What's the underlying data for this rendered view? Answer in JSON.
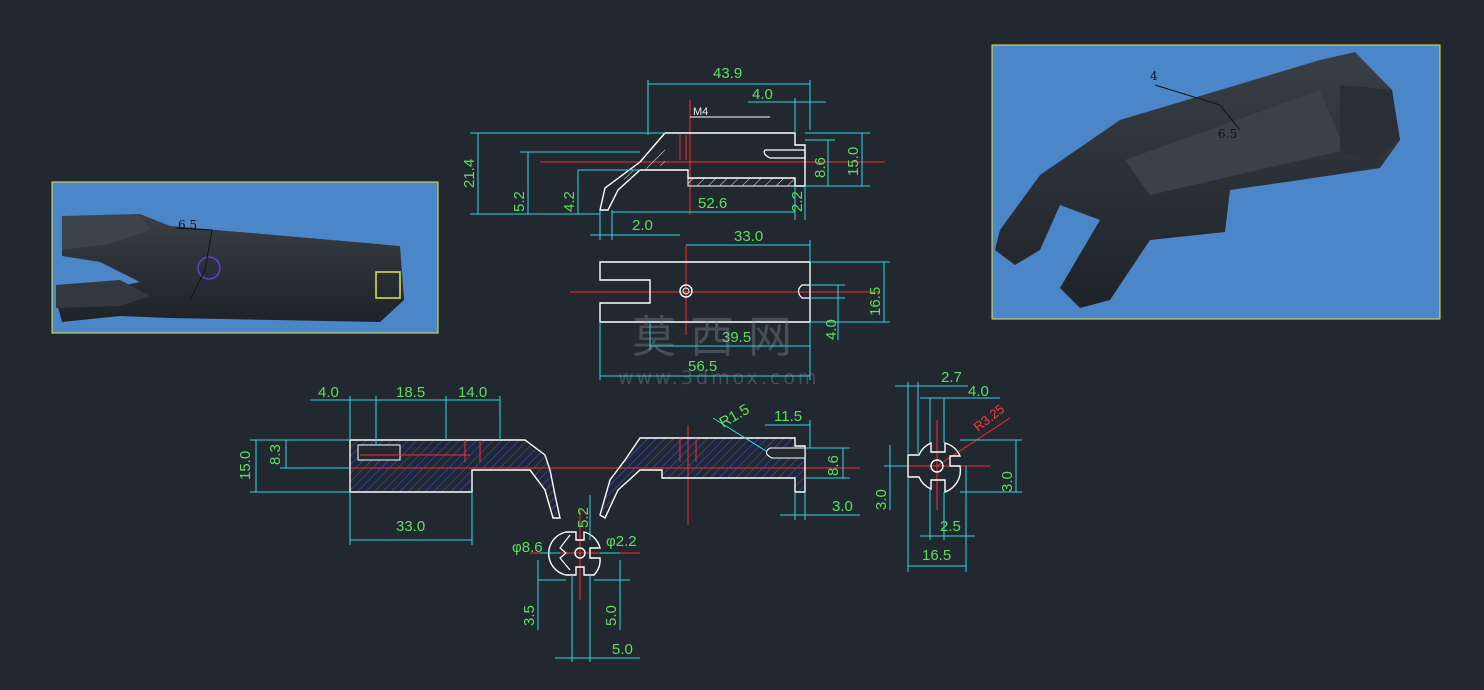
{
  "drawing": {
    "colors": {
      "background": "#212830",
      "outline": "#ffffff",
      "dimension_line": "#2fd6e6",
      "dimension_text": "#5ce05c",
      "center_line": "#ff2a2a",
      "hatch": "#3b4fd8",
      "render_panel": "#4a86c8",
      "panel_border": "#e6e64a"
    },
    "top_view_dims": {
      "overall_width": "43.9",
      "slot_offset": "4.0",
      "thread": "M4",
      "height_total": "21.4",
      "lip_height": "5.2",
      "inner_height": "4.2",
      "lip_depth": "2.0",
      "body_length": "52.6",
      "tail": "2.2",
      "slot_height": "8.6",
      "end_height": "15.0"
    },
    "plan_view_dims": {
      "hole_offset": "33.0",
      "width": "16.5",
      "slot_length": "39.5",
      "slot_width": "4.0",
      "overall_length": "56.5"
    },
    "section_left_dims": {
      "a": "4.0",
      "b": "18.5",
      "c": "14.0",
      "height": "15.0",
      "inner": "8.3",
      "length": "33.0"
    },
    "detail_dims": {
      "radius": "R1.5",
      "slot_len": "11.5",
      "slot_h": "8.6",
      "foot": "3.0",
      "diam_outer": "φ8.6",
      "diam_inner": "φ2.2",
      "key_h": "5.2",
      "left_h": "3.5",
      "right_h": "5.0",
      "bottom_w": "5.0"
    },
    "side_view_dims": {
      "a": "2.7",
      "b": "4.0",
      "radius": "R3.25",
      "left_h": "3.0",
      "right_h": "3.0",
      "inner_w": "2.5",
      "width": "16.5"
    },
    "render_left_label": "6.5",
    "render_right_labels": [
      "4",
      "6.5"
    ],
    "watermark": {
      "cn": "莫西网",
      "url": "www.3dmox.com"
    }
  }
}
